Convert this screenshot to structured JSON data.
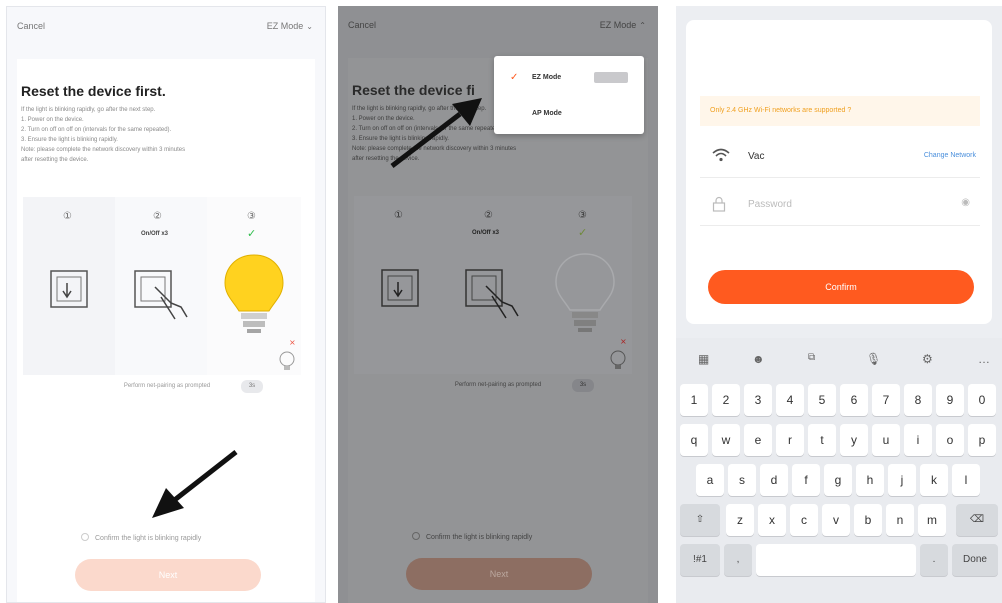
{
  "panel1": {
    "cancel": "Cancel",
    "mode": "EZ Mode",
    "title": "Reset the device first.",
    "steps": [
      "If the light is blinking rapidly, go after the next step.",
      "1. Power on the device.",
      "2. Turn on off on off on (intervals for the same repeated).",
      "3. Ensure the light is blinking rapidly.",
      "Note: please complete the network discovery within 3 minutes",
      "after resetting the device."
    ],
    "wifi_label": "On/Off x3",
    "help": "Perform net-pairing as prompted",
    "help_btn": "3s",
    "confirm_text": "Confirm the light is blinking rapidly",
    "next": "Next"
  },
  "panel2": {
    "cancel": "Cancel",
    "mode": "EZ Mode",
    "title": "Reset the device fi",
    "steps": [
      "If the light is blinking rapidly, go after the next step.",
      "1. Power on the device.",
      "2. Turn on off on off on (intervals for the same repeated).",
      "3. Ensure the light is blinking rapidly.",
      "Note: please complete the network discovery within 3 minutes",
      "after resetting the device."
    ],
    "wifi_label": "On/Off x3",
    "help": "Perform net-pairing as prompted",
    "help_btn": "3s",
    "confirm_text": "Confirm the light is blinking rapidly",
    "next": "Next",
    "menu": [
      {
        "label": "EZ Mode",
        "selected": true
      },
      {
        "label": "AP Mode",
        "selected": false
      }
    ]
  },
  "panel3": {
    "warning": "Only 2.4 GHz Wi-Fi networks are supported ?",
    "ssid": "Vac",
    "change_network": "Change Network",
    "password_placeholder": "Password",
    "confirm": "Confirm",
    "toolbar_icons": [
      "grid-icon",
      "emoji-icon",
      "gif-icon",
      "mic-icon",
      "settings-icon",
      "more-icon"
    ],
    "keyboard": {
      "numbers": [
        "1",
        "2",
        "3",
        "4",
        "5",
        "6",
        "7",
        "8",
        "9",
        "0"
      ],
      "row1": [
        "q",
        "w",
        "e",
        "r",
        "t",
        "y",
        "u",
        "i",
        "o",
        "p"
      ],
      "row2": [
        "a",
        "s",
        "d",
        "f",
        "g",
        "h",
        "j",
        "k",
        "l"
      ],
      "row3": [
        "z",
        "x",
        "c",
        "v",
        "b",
        "n",
        "m"
      ],
      "shift": "⇧",
      "backspace": "⌫",
      "sym": "!#1",
      "comma": ",",
      "dot": ".",
      "done": "Done"
    }
  },
  "colors": {
    "accent": "#ff5a1f",
    "accent_light": "#fbd9cc",
    "warning": "#f0a020",
    "link": "#4a8fdc",
    "success": "#2ebd4b"
  }
}
